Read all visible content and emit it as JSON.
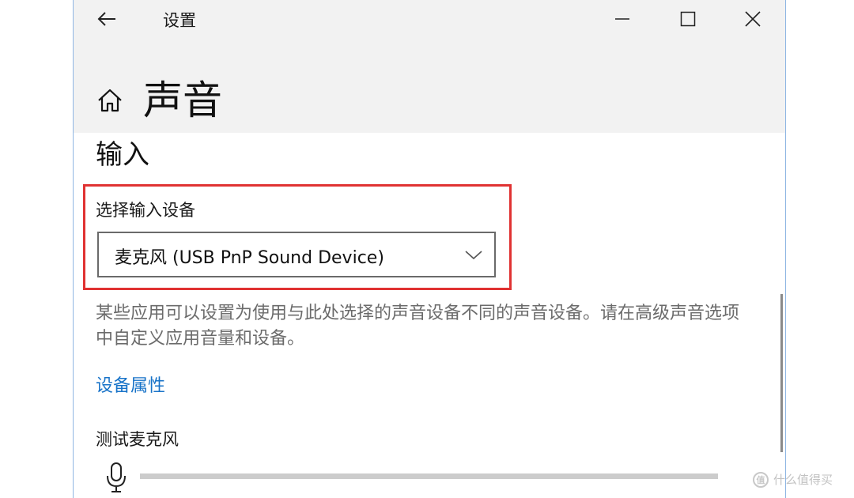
{
  "window": {
    "title": "设置"
  },
  "page": {
    "title": "声音"
  },
  "input_section": {
    "title": "输入",
    "device_label": "选择输入设备",
    "selected_device": "麦克风 (USB PnP Sound Device)",
    "description": "某些应用可以设置为使用与此处选择的声音设备不同的声音设备。请在高级声音选项中自定义应用音量和设备。",
    "device_properties_link": "设备属性",
    "test_mic_label": "测试麦克风",
    "mic_level": 0
  },
  "watermark": {
    "icon_glyph": "值",
    "text": "什么值得买"
  },
  "colors": {
    "accent": "#1873c8",
    "highlight": "#e03232",
    "header_bg": "#f2f2f2"
  },
  "icons": {
    "back": "back-arrow-icon",
    "minimize": "minimize-icon",
    "maximize": "maximize-icon",
    "close": "close-icon",
    "home": "home-icon",
    "dropdown": "chevron-down-icon",
    "microphone": "microphone-icon"
  }
}
